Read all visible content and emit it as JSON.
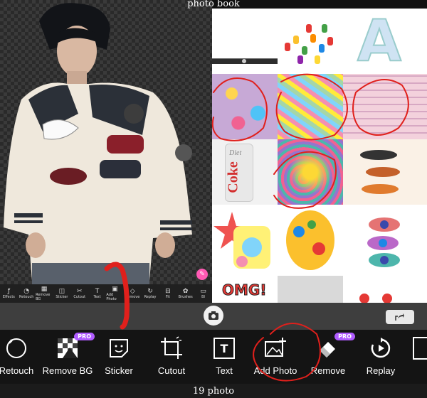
{
  "header": {
    "title": "photo book"
  },
  "footer": {
    "title": "19 photo"
  },
  "editor": {
    "mini_tools": [
      "Effects",
      "Retouch",
      "Remove BG",
      "Sticker",
      "Cutout",
      "Text",
      "Add Photo",
      "Remove",
      "Replay",
      "Fit",
      "Brushes",
      "Bl"
    ]
  },
  "toolbar": {
    "tools": [
      {
        "label": "Retouch",
        "icon": "retouch-icon",
        "pro": false
      },
      {
        "label": "Remove BG",
        "icon": "remove-bg-icon",
        "pro": true
      },
      {
        "label": "Sticker",
        "icon": "sticker-icon",
        "pro": false
      },
      {
        "label": "Cutout",
        "icon": "cutout-icon",
        "pro": false
      },
      {
        "label": "Text",
        "icon": "text-icon",
        "pro": false
      },
      {
        "label": "Add Photo",
        "icon": "add-photo-icon",
        "pro": false
      },
      {
        "label": "Remove",
        "icon": "eraser-icon",
        "pro": true
      },
      {
        "label": "Replay",
        "icon": "replay-icon",
        "pro": false
      }
    ],
    "pro_badge": "PRO",
    "text_glyph": "T"
  },
  "grid": {
    "sticker_letter": "A",
    "coke_text": "Coke",
    "diet_text": "Diet",
    "pop_text": "OMG!"
  },
  "colors": {
    "accent": "#b05cff",
    "annotation": "#e0201c"
  }
}
